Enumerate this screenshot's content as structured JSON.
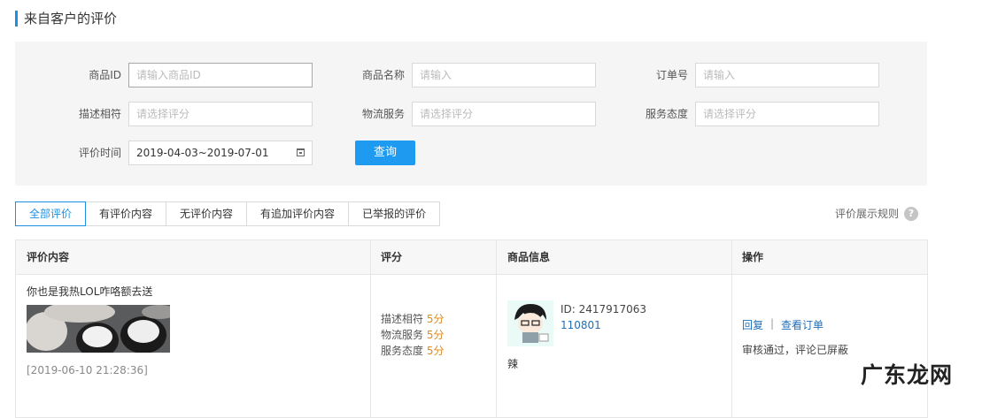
{
  "page": {
    "title": "来自客户的评价"
  },
  "filters": {
    "product_id": {
      "label": "商品ID",
      "placeholder": "请输入商品ID"
    },
    "product_name": {
      "label": "商品名称",
      "placeholder": "请输入"
    },
    "order_no": {
      "label": "订单号",
      "placeholder": "请输入"
    },
    "desc_match": {
      "label": "描述相符",
      "placeholder": "请选择评分"
    },
    "logistics": {
      "label": "物流服务",
      "placeholder": "请选择评分"
    },
    "service": {
      "label": "服务态度",
      "placeholder": "请选择评分"
    },
    "review_time": {
      "label": "评价时间",
      "value": "2019-04-03~2019-07-01"
    },
    "query_label": "查询"
  },
  "tabs": [
    {
      "label": "全部评价",
      "active": true
    },
    {
      "label": "有评价内容"
    },
    {
      "label": "无评价内容"
    },
    {
      "label": "有追加评价内容"
    },
    {
      "label": "已举报的评价"
    }
  ],
  "rules_link": "评价展示规则",
  "help_glyph": "?",
  "table": {
    "headers": [
      "评价内容",
      "评分",
      "商品信息",
      "操作"
    ],
    "rows": [
      {
        "comment": "你也是我热LOL咋咯额去送",
        "time": "[2019-06-10 21:28:36]",
        "scores": [
          {
            "label": "描述相符",
            "value": "5分"
          },
          {
            "label": "物流服务",
            "value": "5分"
          },
          {
            "label": "服务态度",
            "value": "5分"
          }
        ],
        "product": {
          "id": "ID: 2417917063",
          "sku": "110801",
          "name": "辣"
        },
        "actions": {
          "reply": "回复",
          "separator": "|",
          "view_order": "查看订单",
          "status": "审核通过，评论已屏蔽"
        }
      }
    ]
  },
  "watermark": "广东龙网",
  "colors": {
    "accent": "#1e8fe1",
    "button": "#1e9af0",
    "score": "#e08a1e",
    "link": "#1f6fb8"
  }
}
